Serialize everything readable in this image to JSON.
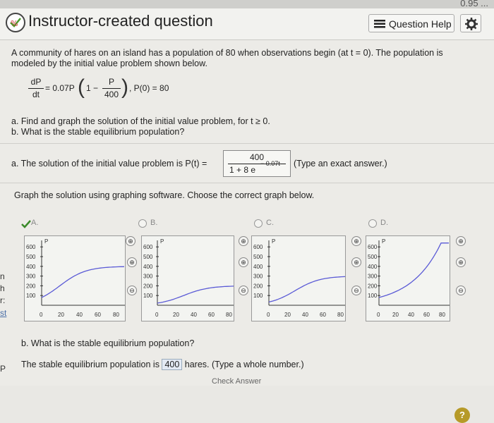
{
  "top": {
    "score": "0.95 ..."
  },
  "header": {
    "title": "Instructor-created question",
    "question_help": "Question Help"
  },
  "sidebar": [
    "n",
    "h",
    "r:",
    "st",
    "P"
  ],
  "problem": {
    "line1": "A community of hares on an island has a population of 80 when observations begin (at t = 0). The population is",
    "line2": "modeled by the initial value problem shown below.",
    "eq_num": "dP",
    "eq_den": "dt",
    "eq_mid": "= 0.07P",
    "eq_paren_left": "1 −",
    "eq_p_num": "P",
    "eq_p_den": "400",
    "eq_tail": ", P(0) = 80",
    "part_a": "a. Find and graph the solution of the initial value problem, for t ≥ 0.",
    "part_b": "b. What is the stable equilibrium population?"
  },
  "answer_a": {
    "label": "a. The solution of the initial value problem is P(t) =",
    "num": "400",
    "den": "1 + 8 e",
    "exp": "− 0.07t",
    "hint": "(Type an exact answer.)"
  },
  "graph_prompt": "Graph the solution using graphing software. Choose the correct graph below.",
  "options": [
    {
      "letter": "A.",
      "selected": true
    },
    {
      "letter": "B.",
      "selected": false
    },
    {
      "letter": "C.",
      "selected": false
    },
    {
      "letter": "D.",
      "selected": false
    }
  ],
  "axis": {
    "y_label": "P",
    "x_label": "t",
    "y_ticks": [
      "600",
      "500",
      "400",
      "300",
      "200",
      "100"
    ],
    "x_ticks": [
      "0",
      "20",
      "40",
      "60",
      "80"
    ]
  },
  "answer_b": {
    "label": "b. What is the stable equilibrium population?",
    "prefix": "The stable equilibrium population is",
    "value": "400",
    "suffix": "hares. (Type a whole number.)"
  },
  "footer": {
    "check": "Check Answer",
    "help": "?"
  },
  "colors": {
    "curve": "#5a5ad6",
    "check": "#3a8a2a"
  }
}
